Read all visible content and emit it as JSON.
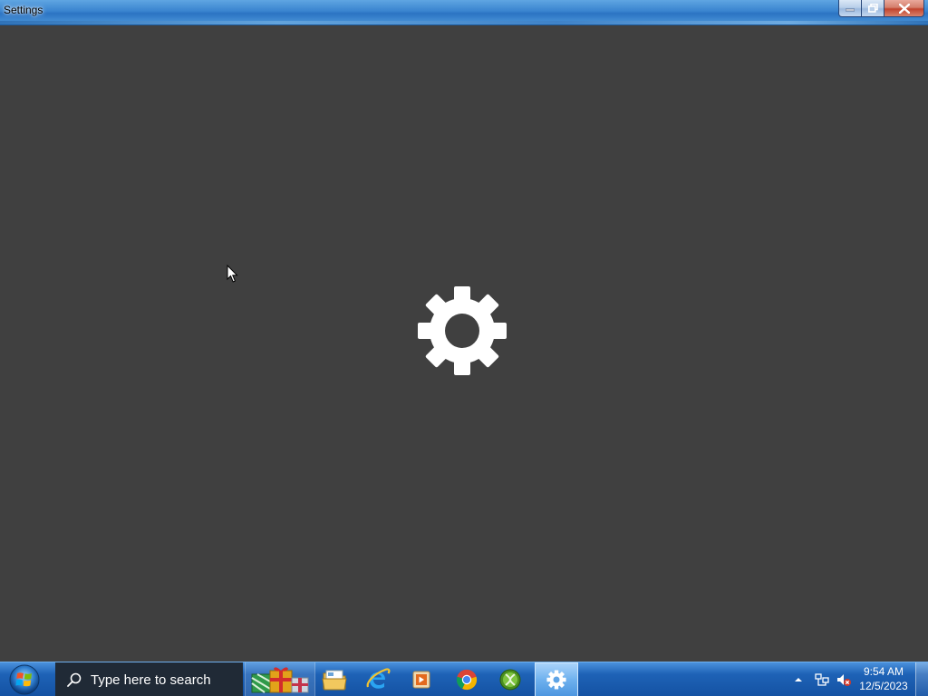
{
  "window": {
    "title": "Settings"
  },
  "taskbar": {
    "search_placeholder": "Type here to search",
    "pinned": [
      {
        "name": "gifts",
        "icon": "gift-boxes-icon"
      },
      {
        "name": "file-explorer",
        "icon": "folder-icon"
      },
      {
        "name": "internet-explorer",
        "icon": "internet-explorer-icon"
      },
      {
        "name": "media-player",
        "icon": "media-player-icon"
      },
      {
        "name": "chrome",
        "icon": "chrome-icon"
      },
      {
        "name": "xbox",
        "icon": "xbox-icon"
      },
      {
        "name": "settings",
        "icon": "gear-icon",
        "active": true
      }
    ],
    "clock": {
      "time": "9:54 AM",
      "date": "12/5/2023"
    }
  },
  "colors": {
    "content_background": "#404040",
    "splash_icon": "#ffffff",
    "taskbar_blue": "#1e62b6",
    "search_box": "#202a36"
  }
}
